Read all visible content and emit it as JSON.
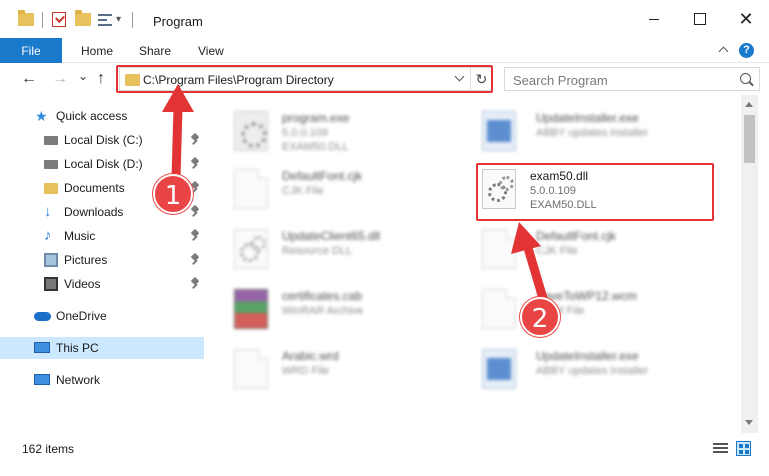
{
  "window": {
    "title": "Program",
    "minimize_icon": "minimize-icon",
    "maximize_icon": "maximize-icon",
    "close_label": "✕"
  },
  "ribbon": {
    "file_tab": "File",
    "tabs": [
      "Home",
      "Share",
      "View"
    ],
    "help_label": "?"
  },
  "address": {
    "path": "C:\\Program Files\\Program Directory",
    "search_placeholder": "Search Program"
  },
  "nav_glyphs": {
    "back": "←",
    "forward": "→",
    "recent": "⌄",
    "up": "↑",
    "refresh": "↻"
  },
  "sidebar": {
    "items": [
      {
        "label": "Quick access",
        "icon": "star-icon"
      },
      {
        "label": "Local Disk (C:)",
        "icon": "disk-icon"
      },
      {
        "label": "Local Disk (D:)",
        "icon": "disk-icon"
      },
      {
        "label": "Documents",
        "icon": "folder-icon"
      },
      {
        "label": "Downloads",
        "icon": "download-icon"
      },
      {
        "label": "Music",
        "icon": "music-icon"
      },
      {
        "label": "Pictures",
        "icon": "pictures-icon"
      },
      {
        "label": "Videos",
        "icon": "videos-icon"
      },
      {
        "label": "OneDrive",
        "icon": "cloud-icon"
      },
      {
        "label": "This PC",
        "icon": "computer-icon",
        "selected": true
      },
      {
        "label": "Network",
        "icon": "network-icon"
      }
    ]
  },
  "files": [
    {
      "name": "program.exe",
      "line1": "5.0.0.109",
      "line2": "EXAM50.DLL",
      "icon": "exe-icon"
    },
    {
      "name": "UpdateInstaller.exe",
      "line1": "ABBY updates installer",
      "line2": "",
      "icon": "window-app-icon"
    },
    {
      "name": "DefaultFont.cjk",
      "line1": "CJK File",
      "line2": "",
      "icon": "document-icon"
    },
    {
      "name": "exam50.dll",
      "line1": "5.0.0.109",
      "line2": "EXAM50.DLL",
      "icon": "dll-gear-icon"
    },
    {
      "name": "UpdateClient65.dll",
      "line1": "Resource DLL",
      "line2": "",
      "icon": "dll-gear-icon"
    },
    {
      "name": "DefaultFont.cjk",
      "line1": "CJK File",
      "line2": "",
      "icon": "document-icon"
    },
    {
      "name": "certificates.cab",
      "line1": "WinRAR Archive",
      "line2": "",
      "icon": "winrar-icon"
    },
    {
      "name": "SaveToWP12.wcm",
      "line1": "WCM File",
      "line2": "",
      "icon": "document-icon"
    },
    {
      "name": "Arabic.wrd",
      "line1": "WRD File",
      "line2": "",
      "icon": "document-icon"
    },
    {
      "name": "UpdateInstaller.exe",
      "line1": "ABBY updates installer",
      "line2": "",
      "icon": "window-app-icon"
    }
  ],
  "status": {
    "item_count": "162 items"
  },
  "annotations": {
    "step1": "1",
    "step2": "2",
    "color": "#e23434"
  },
  "colors": {
    "accent": "#1979ca",
    "selection": "#cce8ff",
    "folder": "#e8c15c"
  }
}
